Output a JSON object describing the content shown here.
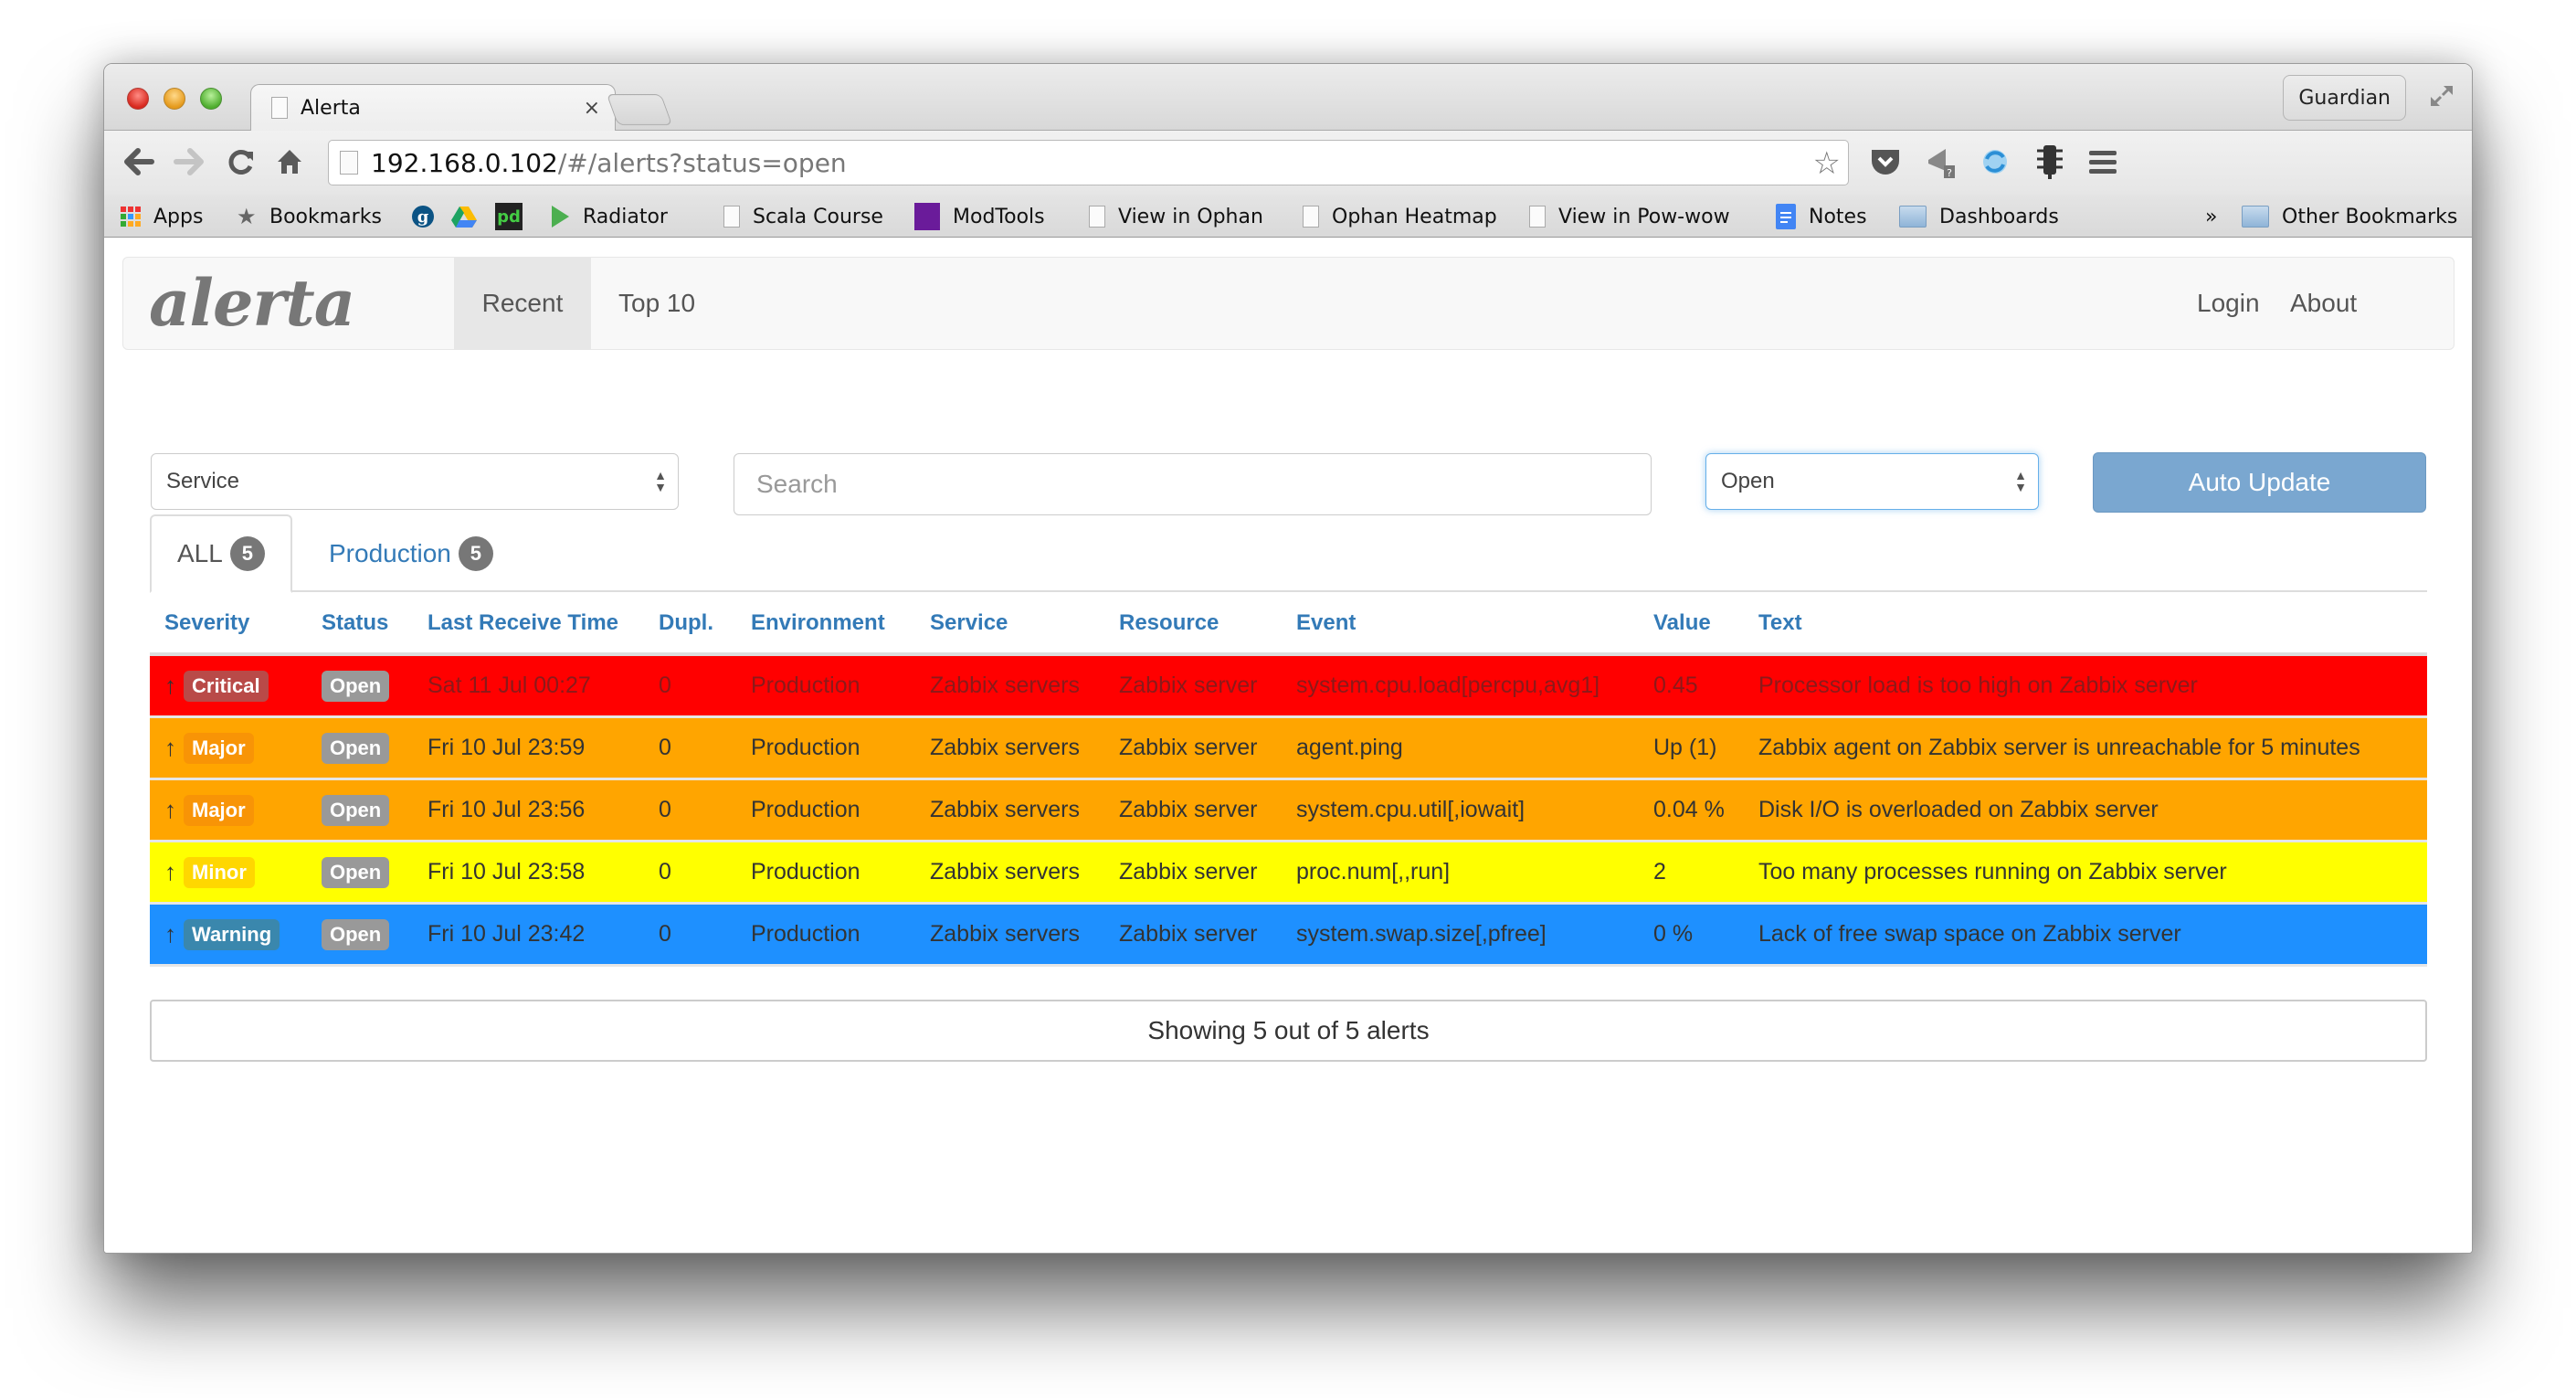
{
  "browser": {
    "tab_title": "Alerta",
    "tab_close": "×",
    "profile_button": "Guardian",
    "url_host": "192.168.0.102",
    "url_path": "/#/alerts?status=open",
    "bookmarks": [
      {
        "label": "Apps",
        "icon": "apps-grid-icon"
      },
      {
        "label": "Bookmarks",
        "icon": "star-icon"
      },
      {
        "label": "",
        "icon": "guardian-g-icon"
      },
      {
        "label": "",
        "icon": "google-drive-icon"
      },
      {
        "label": "",
        "icon": "pagerduty-icon"
      },
      {
        "label": "Radiator",
        "icon": "play-triangle-icon"
      },
      {
        "label": "Scala Course",
        "icon": "page-icon"
      },
      {
        "label": "ModTools",
        "icon": "modtools-icon"
      },
      {
        "label": "View in Ophan",
        "icon": "page-icon"
      },
      {
        "label": "Ophan Heatmap",
        "icon": "page-icon"
      },
      {
        "label": "View in Pow-wow",
        "icon": "page-icon"
      },
      {
        "label": "Notes",
        "icon": "google-docs-icon"
      },
      {
        "label": "Dashboards",
        "icon": "folder-icon"
      }
    ],
    "overflow_chevron": "»",
    "other_bookmarks": "Other Bookmarks"
  },
  "app": {
    "brand": "alerta",
    "nav": [
      {
        "label": "Recent",
        "active": true
      },
      {
        "label": "Top 10",
        "active": false
      }
    ],
    "nav_right": [
      {
        "label": "Login"
      },
      {
        "label": "About"
      }
    ],
    "filters": {
      "group_by_select": "Service",
      "search_placeholder": "Search",
      "search_value": "",
      "status_select": "Open",
      "auto_update_label": "Auto Update"
    },
    "env_tabs": [
      {
        "label": "ALL",
        "count": "5",
        "active": true
      },
      {
        "label": "Production",
        "count": "5",
        "active": false
      }
    ],
    "table": {
      "columns": [
        "Severity",
        "Status",
        "Last Receive Time",
        "Dupl.",
        "Environment",
        "Service",
        "Resource",
        "Event",
        "Value",
        "Text"
      ],
      "rows": [
        {
          "trend": "↑",
          "severity": "Critical",
          "status": "Open",
          "last_receive_time": "Sat 11 Jul 00:27",
          "dupl": "0",
          "environment": "Production",
          "service": "Zabbix servers",
          "resource": "Zabbix server",
          "event": "system.cpu.load[percpu,avg1]",
          "value": "0.45",
          "text": "Processor load is too high on Zabbix server",
          "row_color": "#ff0000",
          "label_color": "#b94a48",
          "text_color": "#8b1a1a"
        },
        {
          "trend": "↑",
          "severity": "Major",
          "status": "Open",
          "last_receive_time": "Fri 10 Jul 23:59",
          "dupl": "0",
          "environment": "Production",
          "service": "Zabbix servers",
          "resource": "Zabbix server",
          "event": "agent.ping",
          "value": "Up (1)",
          "text": "Zabbix agent on Zabbix server is unreachable for 5 minutes",
          "row_color": "#ffa500",
          "label_color": "#f89406",
          "text_color": "#333333"
        },
        {
          "trend": "↑",
          "severity": "Major",
          "status": "Open",
          "last_receive_time": "Fri 10 Jul 23:56",
          "dupl": "0",
          "environment": "Production",
          "service": "Zabbix servers",
          "resource": "Zabbix server",
          "event": "system.cpu.util[,iowait]",
          "value": "0.04 %",
          "text": "Disk I/O is overloaded on Zabbix server",
          "row_color": "#ffa500",
          "label_color": "#f89406",
          "text_color": "#333333"
        },
        {
          "trend": "↑",
          "severity": "Minor",
          "status": "Open",
          "last_receive_time": "Fri 10 Jul 23:58",
          "dupl": "0",
          "environment": "Production",
          "service": "Zabbix servers",
          "resource": "Zabbix server",
          "event": "proc.num[,,run]",
          "value": "2",
          "text": "Too many processes running on Zabbix server",
          "row_color": "#ffff00",
          "label_color": "#ffd700",
          "text_color": "#333333"
        },
        {
          "trend": "↑",
          "severity": "Warning",
          "status": "Open",
          "last_receive_time": "Fri 10 Jul 23:42",
          "dupl": "0",
          "environment": "Production",
          "service": "Zabbix servers",
          "resource": "Zabbix server",
          "event": "system.swap.size[,pfree]",
          "value": "0 %",
          "text": "Lack of free swap space on Zabbix server",
          "row_color": "#1e90ff",
          "label_color": "#3a87ad",
          "text_color": "#333333"
        }
      ]
    },
    "footer_text": "Showing 5 out of 5 alerts"
  }
}
